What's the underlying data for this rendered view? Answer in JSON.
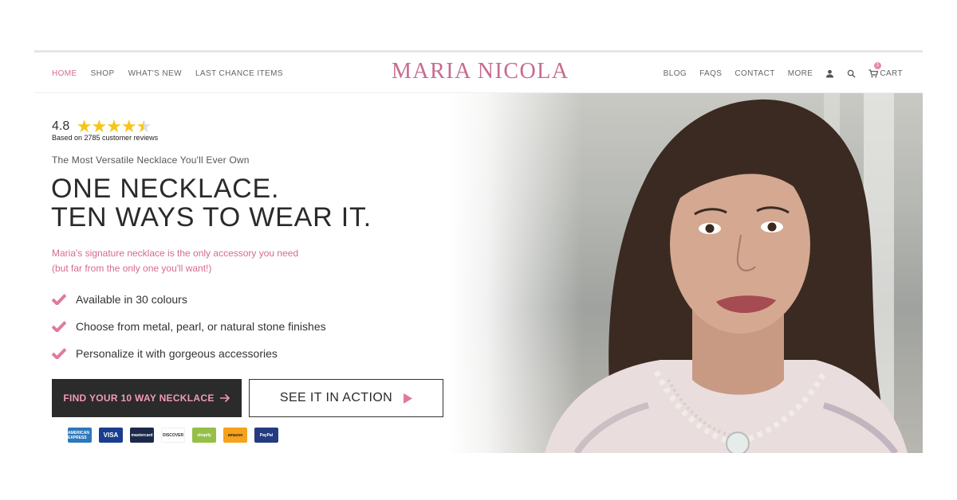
{
  "nav": {
    "left": [
      "HOME",
      "SHOP",
      "WHAT'S NEW",
      "LAST CHANCE ITEMS"
    ],
    "brand": "MARIA NICOLA",
    "right": [
      "BLOG",
      "FAQS",
      "CONTACT",
      "MORE"
    ],
    "cart_label": "CART",
    "cart_count": "1",
    "active": "HOME"
  },
  "rating": {
    "score": "4.8",
    "stars": 4.5,
    "reviews_text": "Based on 2785 customer reviews"
  },
  "hero": {
    "tagline": "The Most Versatile Necklace You'll Ever Own",
    "headline_line1": "ONE NECKLACE.",
    "headline_line2": "TEN WAYS TO WEAR IT.",
    "sub_line1": "Maria's signature necklace is the only accessory you need",
    "sub_line2": "(but far from the only one you'll want!)",
    "features": [
      "Available in 30 colours",
      "Choose from metal, pearl, or natural stone finishes",
      "Personalize it with gorgeous accessories"
    ],
    "primary_cta": "FIND YOUR 10 WAY NECKLACE",
    "secondary_cta": "SEE IT IN ACTION"
  },
  "payments": [
    {
      "name": "AMERICAN EXPRESS",
      "color": "#2e77bb"
    },
    {
      "name": "VISA",
      "color": "#1a3d8f"
    },
    {
      "name": "mastercard",
      "color": "#1b2a4a"
    },
    {
      "name": "DISCOVER",
      "color": "#ffffff"
    },
    {
      "name": "shopify",
      "color": "#95bf47"
    },
    {
      "name": "amazon",
      "color": "#f6a21a"
    },
    {
      "name": "PayPal",
      "color": "#253b80"
    }
  ],
  "colors": {
    "accent_pink": "#d66a8f",
    "dark_button": "#2b2b2b",
    "star": "#f5c518"
  }
}
